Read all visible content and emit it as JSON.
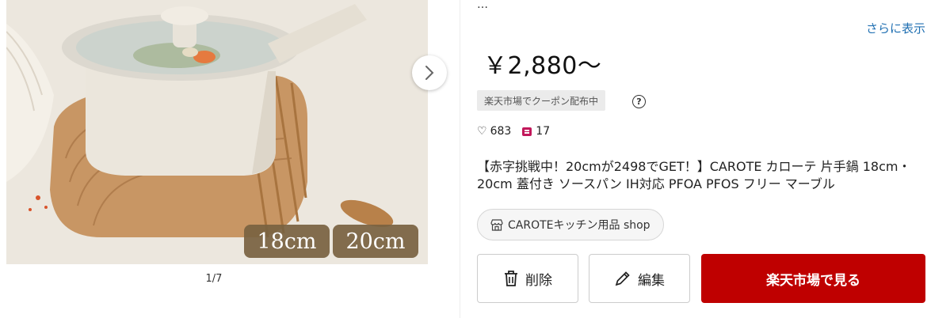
{
  "gallery": {
    "counter": "1/7",
    "size_tags": [
      "18cm",
      "20cm"
    ],
    "next_icon": "chevron-right-icon"
  },
  "product": {
    "truncated_text": "…",
    "more_link": "さらに表示",
    "price": "￥2,880〜",
    "coupon_badge": "楽天市場でクーポン配布中",
    "help_icon": "?",
    "likes": "683",
    "comments": "17",
    "title": "【赤字挑戦中！20cmが2498でGET！】CAROTE カローテ 片手鍋 18cm・20cm 蓋付き ソースパン IH対応 PFOA PFOS フリー マーブル",
    "shop": "CAROTEキッチン用品 shop"
  },
  "actions": {
    "delete_label": "削除",
    "edit_label": "編集",
    "rakuten_label": "楽天市場で見る"
  },
  "colors": {
    "accent": "#bf0000",
    "link": "#1f6fb2",
    "comment_badge": "#c2185b",
    "size_tag_bg": "#786240"
  }
}
